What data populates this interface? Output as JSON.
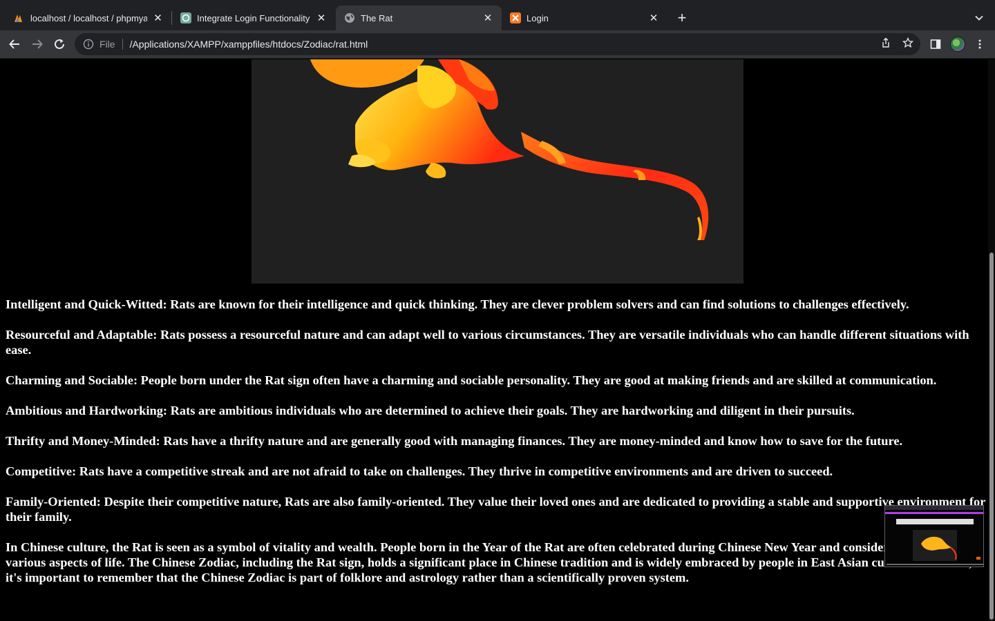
{
  "browser": {
    "tabs": [
      {
        "title": "localhost / localhost / phpmyad",
        "favicon": "phpmyadmin-icon",
        "active": false
      },
      {
        "title": "Integrate Login Functionality",
        "favicon": "chatgpt-icon",
        "active": false
      },
      {
        "title": "The Rat",
        "favicon": "globe-icon",
        "active": true
      },
      {
        "title": "Login",
        "favicon": "xampp-icon",
        "active": false
      }
    ],
    "new_tab_label": "+",
    "address": {
      "scheme": "File",
      "url": "/Applications/XAMPP/xamppfiles/htdocs/Zodiac/rat.html"
    }
  },
  "page": {
    "background": "#000000",
    "text_color": "#ffffff",
    "image_alt": "rat illustration",
    "paragraphs": [
      "Intelligent and Quick-Witted: Rats are known for their intelligence and quick thinking. They are clever problem solvers and can find solutions to challenges effectively.",
      "Resourceful and Adaptable: Rats possess a resourceful nature and can adapt well to various circumstances. They are versatile individuals who can handle different situations with ease.",
      "Charming and Sociable: People born under the Rat sign often have a charming and sociable personality. They are good at making friends and are skilled at communication.",
      "Ambitious and Hardworking: Rats are ambitious individuals who are determined to achieve their goals. They are hardworking and diligent in their pursuits.",
      "Thrifty and Money-Minded: Rats have a thrifty nature and are generally good with managing finances. They are money-minded and know how to save for the future.",
      "Competitive: Rats have a competitive streak and are not afraid to take on challenges. They thrive in competitive environments and are driven to succeed.",
      "Family-Oriented: Despite their competitive nature, Rats are also family-oriented. They value their loved ones and are dedicated to providing a stable and supportive environment for their family.",
      "In Chinese culture, the Rat is seen as a symbol of vitality and wealth. People born in the Year of the Rat are often celebrated during Chinese New Year and considered fortunate in various aspects of life. The Chinese Zodiac, including the Rat sign, holds a significant place in Chinese tradition and is widely embraced by people in East Asian cultures. However, it's important to remember that the Chinese Zodiac is part of folklore and astrology rather than a scientifically proven system."
    ]
  }
}
